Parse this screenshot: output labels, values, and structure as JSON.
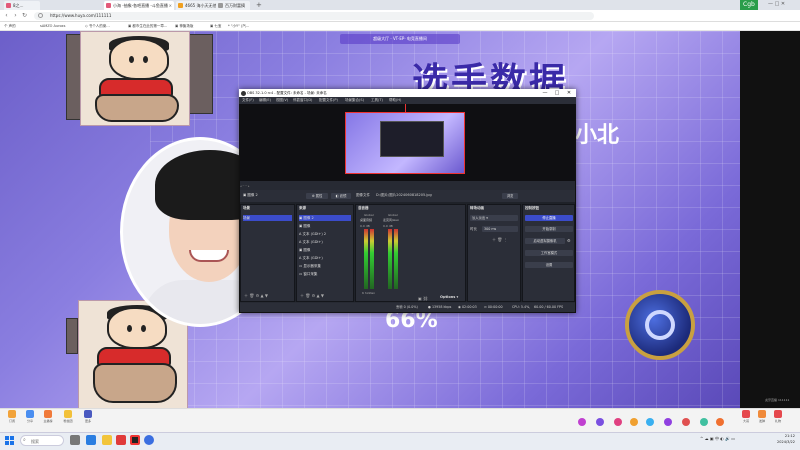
{
  "browser": {
    "tabs": [
      {
        "label": "8之…"
      },
      {
        "label": "小海 -抽象-各吧直播 -斗鱼直播"
      },
      {
        "label": "4665  海小天无他地直播 - 斗…"
      },
      {
        "label": "百万财富摘"
      }
    ],
    "url": "https://www.huya.com/111111",
    "bookmarks": [
      "个 声的",
      "sAMZO Auroxs",
      "◇ 书个人的案…",
      "▣ 都市生在此的第一章…",
      "▣ 神聚场版",
      "▣ 七宝",
      "* \"小Y\" (汽…"
    ],
    "ext_text": "Cgb"
  },
  "stream": {
    "banner": "超级大厅 · VT·EP· 电竞直播间",
    "title": "选手数据",
    "subtitle": "小北",
    "percent": "66%",
    "watermark": "虎牙直播 111111"
  },
  "obs": {
    "title": "OBS 32.1.0 rc4 - 配置文件: 未命名 - 场景: 未命名",
    "window_controls": {
      "minimize": "—",
      "maximize": "□",
      "close": "✕"
    },
    "menu": [
      "文件(F)",
      "编辑(E)",
      "视图(V)",
      "停靠窗口(D)",
      "配置文件(P)",
      "场景集合(S)",
      "工具(T)",
      "帮助(H)"
    ],
    "toolbar": {
      "source_name": "图像 2",
      "properties": "属性",
      "filters": "滤镜",
      "file_label": "图像文件",
      "file_path": "D:/图片/图片2024060818205.jpg",
      "browse": "浏览"
    },
    "scenes": {
      "title": "场景",
      "items": [
        "场景"
      ]
    },
    "sources": {
      "title": "来源",
      "items": [
        "图像 2",
        "图像",
        "文本 (GDI+) 2",
        "文本 (GDI+)",
        "图像",
        "文本 (GDI+)",
        "显示器采集",
        "窗口采集"
      ]
    },
    "mixer": {
      "title": "混音器",
      "channels": [
        {
          "name": "Global",
          "label": "桌面音频",
          "value": "0.0 dB"
        },
        {
          "name": "Global",
          "label": "麦克风/Aux",
          "value": "0.0 dB"
        }
      ],
      "hidden": "6 hidden",
      "options": "Options"
    },
    "transitions": {
      "title": "转场动画",
      "type": "淡入淡出",
      "duration_label": "时长",
      "duration": "300 ms"
    },
    "controls": {
      "title": "控制按钮",
      "buttons": [
        "停止直播",
        "开始录制",
        "启动虚拟摄像机",
        "工作室模式",
        "设置"
      ]
    },
    "status": {
      "frames": "丢帧 0 (0.0%)",
      "bitrate": "13958 kbps",
      "rec": "02:00:03",
      "stream_time": "00:00:00",
      "cpu": "CPU: 5.4%,",
      "fps": "60.00 / 60.00 FPS"
    }
  },
  "page_bottom": {
    "items": [
      "订阅",
      "分享",
      "主播榜",
      "粉丝团",
      "更多"
    ],
    "right_items": [
      "大哥",
      "发弹",
      "礼物"
    ]
  },
  "taskbar": {
    "search_placeholder": "搜索",
    "time": "21:12",
    "date": "2024/3/22"
  }
}
